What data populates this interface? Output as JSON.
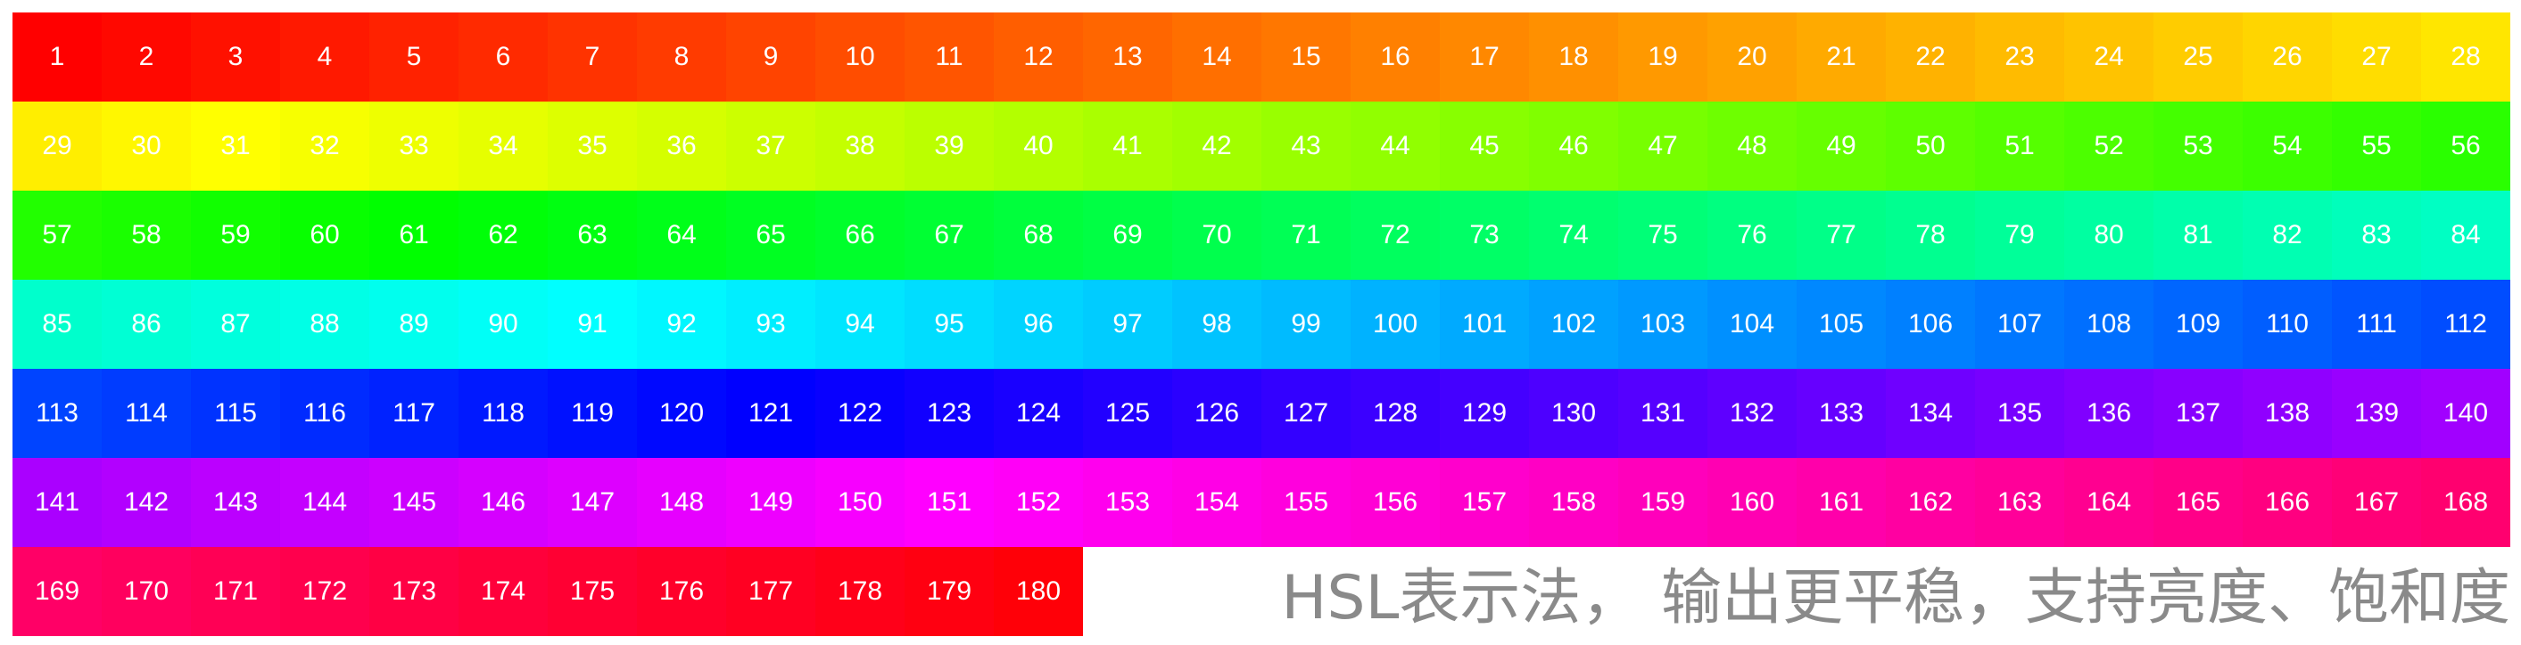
{
  "palette": {
    "count": 180,
    "columns": 28,
    "saturation_percent": 100,
    "lightness_percent": 50,
    "label_color": "#ffffff"
  },
  "caption": "HSL表示法， 输出更平稳，支持亮度、饱和度",
  "caption_color": "#8a8a8a"
}
